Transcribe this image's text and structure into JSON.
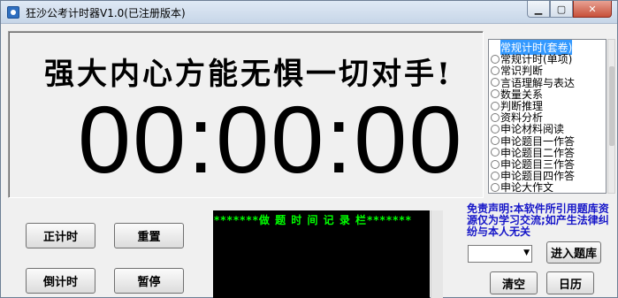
{
  "window": {
    "title": "狂沙公考计时器V1.0(已注册版本)",
    "controls": {
      "minimize": "▁",
      "maximize": "▢",
      "close": "✕"
    }
  },
  "display": {
    "slogan": "强大内心方能无惧一切对手!",
    "time": "00:00:00"
  },
  "modes": [
    {
      "label": "常规计时(套卷)",
      "selected": true
    },
    {
      "label": "常规计时(单项)",
      "selected": false
    },
    {
      "label": "常识判断",
      "selected": false
    },
    {
      "label": "言语理解与表达",
      "selected": false
    },
    {
      "label": "数量关系",
      "selected": false
    },
    {
      "label": "判断推理",
      "selected": false
    },
    {
      "label": "资料分析",
      "selected": false
    },
    {
      "label": "申论材料阅读",
      "selected": false
    },
    {
      "label": "申论题目一作答",
      "selected": false
    },
    {
      "label": "申论题目二作答",
      "selected": false
    },
    {
      "label": "申论题目三作答",
      "selected": false
    },
    {
      "label": "申论题目四作答",
      "selected": false
    },
    {
      "label": "申论大作文",
      "selected": false
    }
  ],
  "buttons": {
    "count_up": "正计时",
    "reset": "重置",
    "count_down": "倒计时",
    "pause": "暂停",
    "enter_bank": "进入题库",
    "clear": "清空",
    "calendar": "日历"
  },
  "record": {
    "header": "*******做 题 时 间 记 录 栏*******"
  },
  "disclaimer": "免责声明:本软件所引用题库资源仅为学习交流;如产生法律纠纷与本人无关",
  "combo": {
    "value": ""
  },
  "colors": {
    "record_bg": "#000000",
    "record_text": "#00ff00",
    "disclaimer": "#1515c8",
    "selection": "#3399ff"
  }
}
